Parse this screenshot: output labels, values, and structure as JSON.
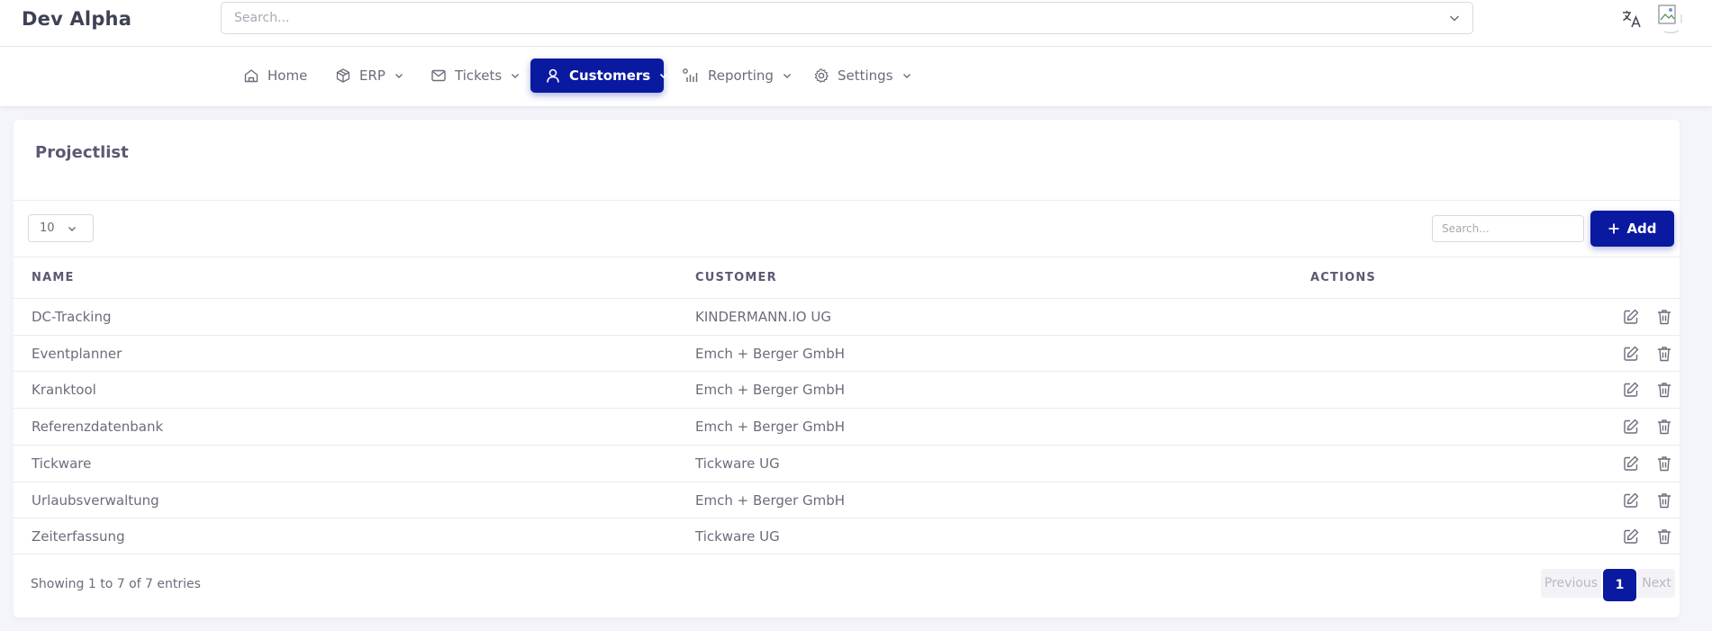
{
  "header": {
    "brand": "Dev Alpha",
    "search_placeholder": "Search..."
  },
  "nav": [
    {
      "label": "Home",
      "icon": "home-icon"
    },
    {
      "label": "ERP",
      "icon": "box-icon"
    },
    {
      "label": "Tickets",
      "icon": "mail-icon"
    },
    {
      "label": "Customers",
      "icon": "user-icon",
      "active": true
    },
    {
      "label": "Reporting",
      "icon": "bar-chart-icon"
    },
    {
      "label": "Settings",
      "icon": "gear-icon"
    }
  ],
  "card": {
    "title": "Projectlist",
    "page_length": "10",
    "search_placeholder": "Search...",
    "add_label": "Add"
  },
  "table": {
    "columns": [
      "NAME",
      "CUSTOMER",
      "ACTIONS"
    ],
    "rows": [
      {
        "name": "DC-Tracking",
        "customer": "KINDERMANN.IO UG"
      },
      {
        "name": "Eventplanner",
        "customer": "Emch + Berger GmbH"
      },
      {
        "name": "Kranktool",
        "customer": "Emch + Berger GmbH"
      },
      {
        "name": "Referenzdatenbank",
        "customer": "Emch + Berger GmbH"
      },
      {
        "name": "Tickware",
        "customer": "Tickware UG"
      },
      {
        "name": "Urlaubsverwaltung",
        "customer": "Emch + Berger GmbH"
      },
      {
        "name": "Zeiterfassung",
        "customer": "Tickware UG"
      }
    ]
  },
  "footer": {
    "info": "Showing 1 to 7 of 7 entries",
    "previous": "Previous",
    "current_page": "1",
    "next": "Next"
  },
  "colors": {
    "primary": "#0a1aa0",
    "background": "#f4f5fa",
    "text": "#6e6b7b"
  }
}
